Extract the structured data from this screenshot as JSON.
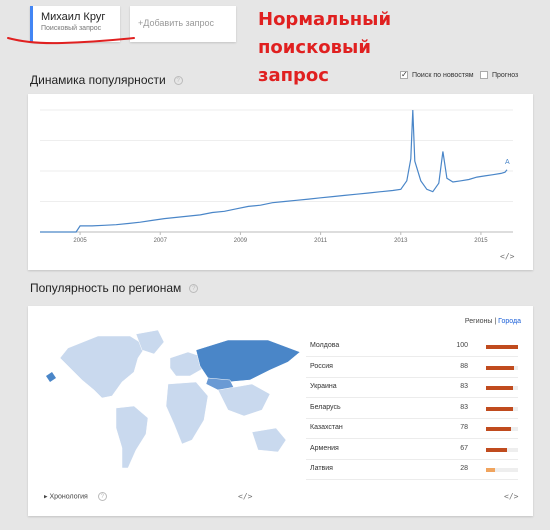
{
  "query": {
    "term": "Михаил Круг",
    "subtitle": "Поисковый запрос",
    "add_label": "+Добавить запрос"
  },
  "annotation": {
    "lines": [
      "Нормальный",
      "поисковый",
      "запрос"
    ],
    "color": "#e02020"
  },
  "interest": {
    "title": "Динамика популярности",
    "news_label": "Поиск по новостям",
    "forecast_label": "Прогноз",
    "news_checked": true,
    "forecast_checked": false,
    "marker": "A",
    "embed_icon": "embed-code-icon"
  },
  "chart_data": {
    "type": "line",
    "x_ticks": [
      "2005",
      "2007",
      "2009",
      "2011",
      "2013",
      "2015"
    ],
    "ylim": [
      0,
      100
    ],
    "series": [
      {
        "color": "#4a86c8",
        "points": [
          [
            2004.0,
            0
          ],
          [
            2004.5,
            0
          ],
          [
            2004.9,
            0
          ],
          [
            2005.0,
            5
          ],
          [
            2005.3,
            5
          ],
          [
            2005.6,
            5.5
          ],
          [
            2005.9,
            6
          ],
          [
            2006.2,
            7
          ],
          [
            2006.5,
            8
          ],
          [
            2006.8,
            9.5
          ],
          [
            2007.1,
            11
          ],
          [
            2007.4,
            12
          ],
          [
            2007.7,
            13
          ],
          [
            2008.0,
            14
          ],
          [
            2008.3,
            16
          ],
          [
            2008.6,
            17
          ],
          [
            2008.9,
            19
          ],
          [
            2009.2,
            21
          ],
          [
            2009.5,
            22
          ],
          [
            2009.8,
            24
          ],
          [
            2010.1,
            25
          ],
          [
            2010.4,
            26
          ],
          [
            2010.7,
            27
          ],
          [
            2011.0,
            28
          ],
          [
            2011.3,
            29
          ],
          [
            2011.6,
            30
          ],
          [
            2011.9,
            31
          ],
          [
            2012.2,
            32
          ],
          [
            2012.5,
            33
          ],
          [
            2012.8,
            34
          ],
          [
            2013.0,
            35
          ],
          [
            2013.15,
            42
          ],
          [
            2013.25,
            60
          ],
          [
            2013.3,
            100
          ],
          [
            2013.35,
            58
          ],
          [
            2013.5,
            42
          ],
          [
            2013.65,
            35
          ],
          [
            2013.8,
            33
          ],
          [
            2013.95,
            40
          ],
          [
            2014.05,
            66
          ],
          [
            2014.15,
            44
          ],
          [
            2014.3,
            41
          ],
          [
            2014.5,
            42
          ],
          [
            2014.7,
            43
          ],
          [
            2014.9,
            45
          ],
          [
            2015.1,
            46
          ],
          [
            2015.3,
            47
          ],
          [
            2015.5,
            48
          ],
          [
            2015.6,
            49
          ],
          [
            2015.65,
            51
          ]
        ]
      }
    ]
  },
  "region": {
    "title": "Популярность по регионам",
    "tab_regions": "Регионы",
    "tab_separator": "|",
    "tab_cities": "Города",
    "chronology_label": "Хронология",
    "embed_icon": "embed-code-icon",
    "bar_colors": {
      "high": "#c04b1e",
      "low": "#f0a45e"
    },
    "rows": [
      {
        "name": "Молдова",
        "value": 100
      },
      {
        "name": "Россия",
        "value": 88
      },
      {
        "name": "Украина",
        "value": 83
      },
      {
        "name": "Беларусь",
        "value": 83
      },
      {
        "name": "Казахстан",
        "value": 78
      },
      {
        "name": "Армения",
        "value": 67
      },
      {
        "name": "Латвия",
        "value": 28
      }
    ]
  }
}
